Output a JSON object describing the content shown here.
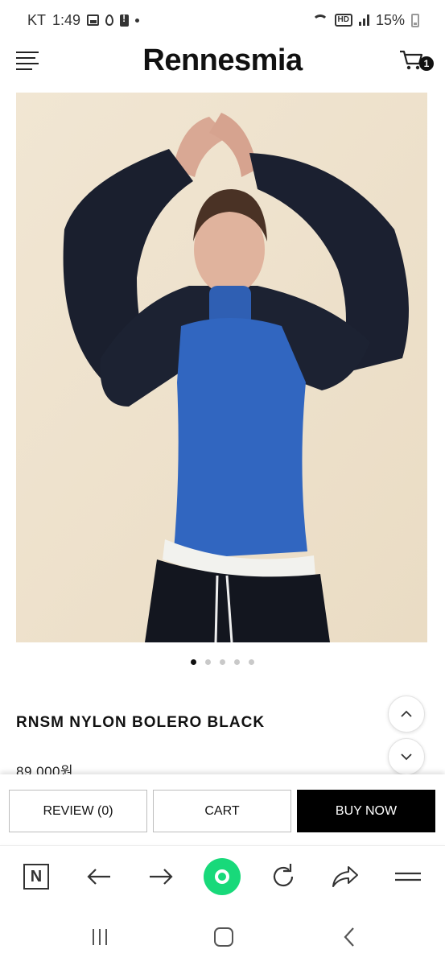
{
  "status_bar": {
    "carrier": "KT",
    "time": "1:49",
    "hd_label": "HD",
    "battery": "15%"
  },
  "header": {
    "brand": "Rennesmia",
    "cart_count": "1"
  },
  "product": {
    "image_slides_total": 5,
    "image_slide_active": 1,
    "name": "RNSM NYLON BOLERO BLACK",
    "price": "89,000원"
  },
  "actions": {
    "review_label": "REVIEW (0)",
    "cart_label": "CART",
    "buy_label": "BUY NOW"
  },
  "browser_toolbar": {
    "naver_logo": "N",
    "icons": [
      "naver-home-icon",
      "back-arrow-icon",
      "forward-arrow-icon",
      "green-dot-button",
      "refresh-icon",
      "share-icon",
      "menu-icon"
    ]
  },
  "system_nav": {
    "icons": [
      "recent-apps-icon",
      "home-icon",
      "back-icon"
    ]
  },
  "colors": {
    "accent_green": "#18d97a",
    "buy_button_bg": "#000000",
    "image_background": "#efe3cf"
  }
}
